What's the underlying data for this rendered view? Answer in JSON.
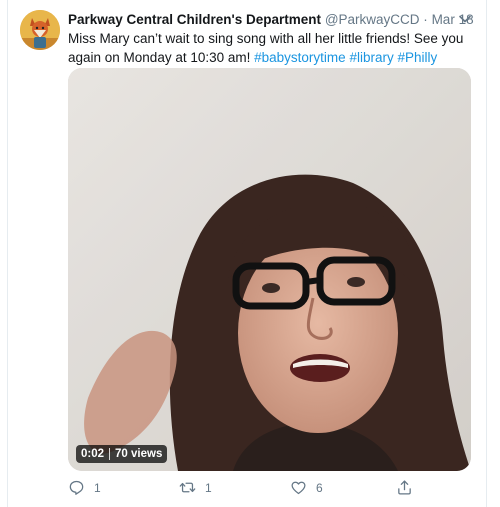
{
  "tweet": {
    "author_name": "Parkway Central Children's Department",
    "handle": "@ParkwayCCD",
    "separator": "·",
    "date": "Mar 18",
    "text_plain": "Miss Mary can’t wait to sing song with all her little friends! See you again on Monday at 10:30 am! ",
    "hashtags": [
      "#babystorytime",
      "#library",
      "#Philly"
    ],
    "avatar_icon": "fox-avatar",
    "video": {
      "time": "0:02",
      "views": "70 views"
    },
    "actions": {
      "reply_count": "1",
      "retweet_count": "1",
      "like_count": "6"
    }
  },
  "colors": {
    "link": "#1b95e0",
    "muted": "#657786",
    "text": "#14171a",
    "border": "#e6ecf0"
  }
}
